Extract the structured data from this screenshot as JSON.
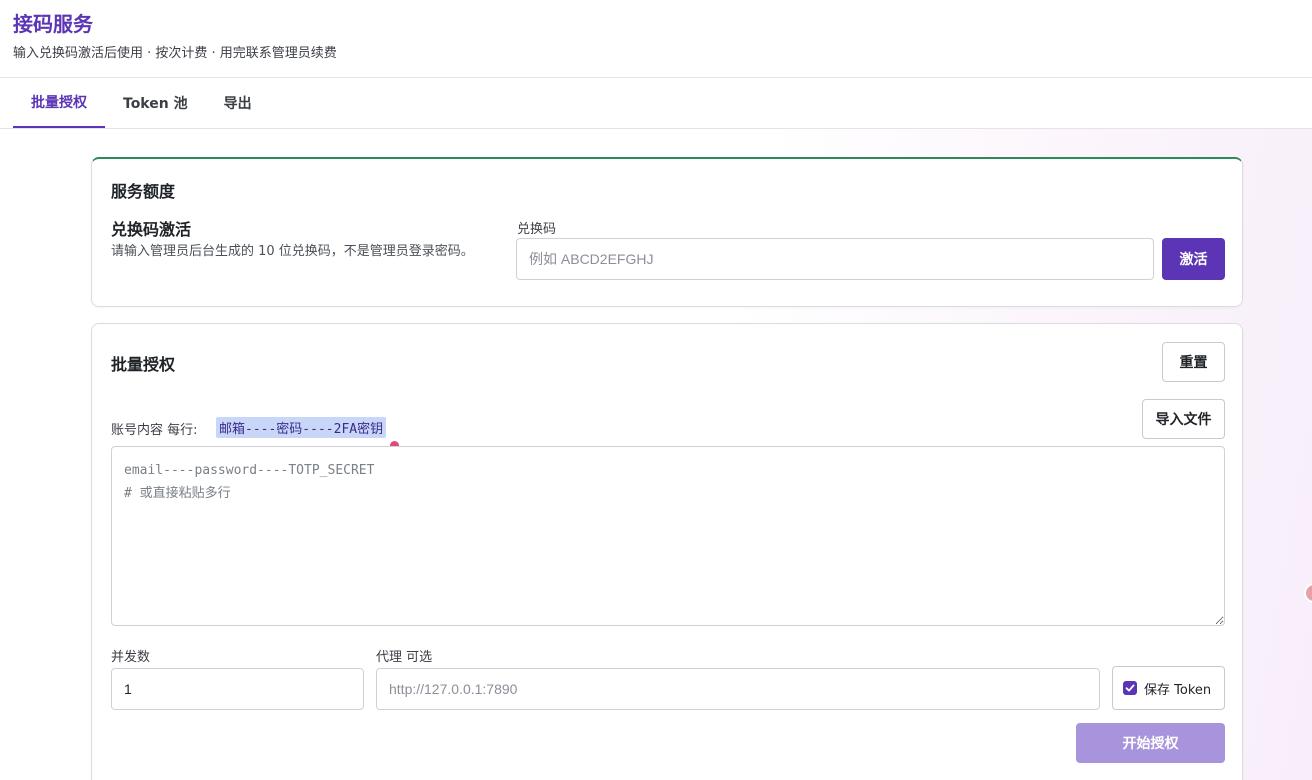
{
  "app": {
    "title": "接码服务",
    "subtitle": "输入兑换码激活后使用 · 按次计费 · 用完联系管理员续费"
  },
  "tabs": [
    {
      "label": "批量授权",
      "active": true
    },
    {
      "label": "Token 池",
      "active": false
    },
    {
      "label": "导出",
      "active": false
    }
  ],
  "quota": {
    "title": "服务额度",
    "section_title": "兑换码激活",
    "description": "请输入管理员后台生成的 10 位兑换码，不是管理员登录密码。",
    "code_label": "兑换码",
    "code_placeholder": "例如 ABCD2EFGHJ",
    "code_value": "",
    "activate_label": "激活"
  },
  "batch": {
    "title": "批量授权",
    "reset_label": "重置",
    "import_label": "导入文件",
    "accounts_label": "账号内容 每行:",
    "format_hint": "邮箱----密码----2FA密钥",
    "accounts_placeholder": "email----password----TOTP_SECRET\n# 或直接粘贴多行",
    "accounts_value": "",
    "concurrency_label": "并发数",
    "concurrency_value": "1",
    "proxy_label": "代理 可选",
    "proxy_placeholder": "http://127.0.0.1:7890",
    "proxy_value": "",
    "save_token_label": "保存 Token",
    "save_token_checked": true,
    "start_label": "开始授权"
  },
  "colors": {
    "accent": "#5b35b5",
    "accent_disabled": "#a794dc",
    "quota_border": "#2f8a5a",
    "hint_highlight": "#c8d6f8"
  }
}
